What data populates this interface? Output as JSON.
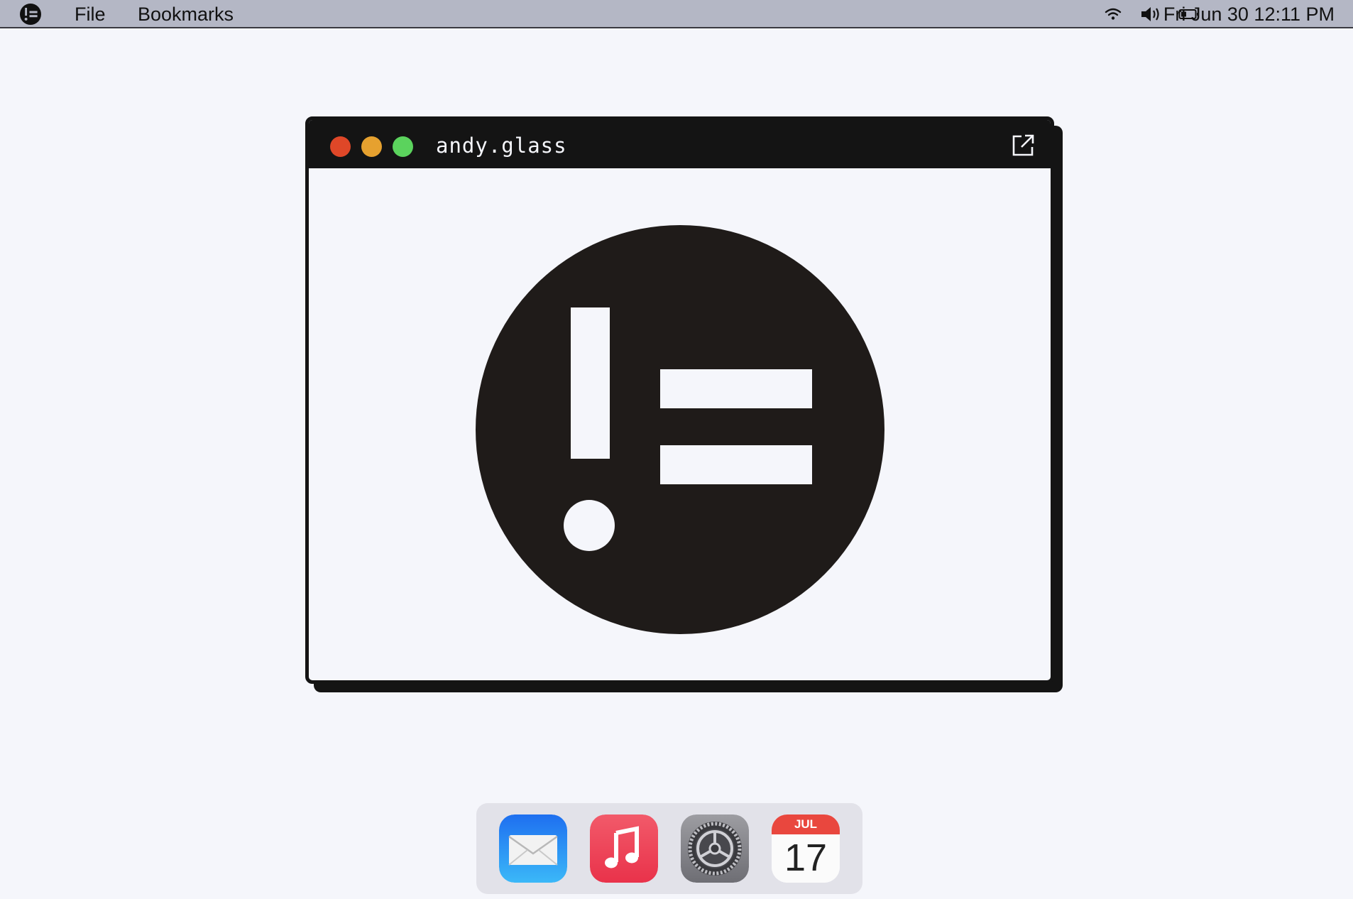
{
  "menubar": {
    "logo_icon": "andy-glass-logo-icon",
    "items": [
      {
        "label": "File"
      },
      {
        "label": "Bookmarks"
      }
    ],
    "status": {
      "wifi_icon": "wifi-icon",
      "volume_icon": "speaker-volume-icon",
      "battery_icon": "battery-icon",
      "clock": "Fri Jun 30 12:11 PM"
    }
  },
  "window": {
    "title": "andy.glass",
    "popout_icon": "external-link-icon",
    "content_logo_icon": "andy-glass-logo-icon",
    "traffic_lights": {
      "close_color": "#df4728",
      "minimize_color": "#e6a12f",
      "zoom_color": "#5bd35d"
    }
  },
  "dock": {
    "apps": [
      {
        "name": "Mail",
        "icon": "mail-icon"
      },
      {
        "name": "Music",
        "icon": "music-icon"
      },
      {
        "name": "System Preferences",
        "icon": "settings-gear-icon"
      },
      {
        "name": "Calendar",
        "icon": "calendar-icon",
        "month": "JUL",
        "day": "17"
      }
    ]
  },
  "colors": {
    "background": "#f5f6fb",
    "menubar": "#b4b7c5",
    "window_chrome": "#141414",
    "logo": "#1f1b19"
  }
}
